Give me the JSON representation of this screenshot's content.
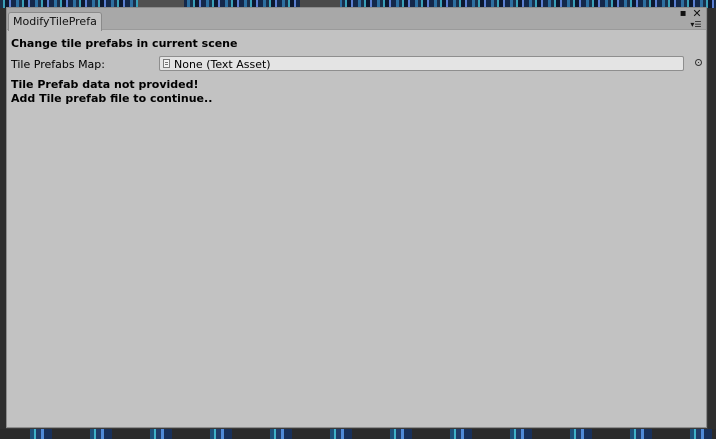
{
  "window": {
    "tab_title": "ModifyTilePrefa"
  },
  "panel": {
    "heading": "Change tile prefabs in current scene",
    "field": {
      "label": "Tile Prefabs Map:",
      "value": "None (Text Asset)"
    },
    "messages": [
      "Tile Prefab data not provided!",
      "Add Tile prefab file to continue.."
    ]
  },
  "icons": {
    "maximize": "maximize-icon",
    "close": "close-icon",
    "menu": "menu-icon",
    "asset": "text-asset-icon",
    "picker": "object-picker-icon"
  }
}
